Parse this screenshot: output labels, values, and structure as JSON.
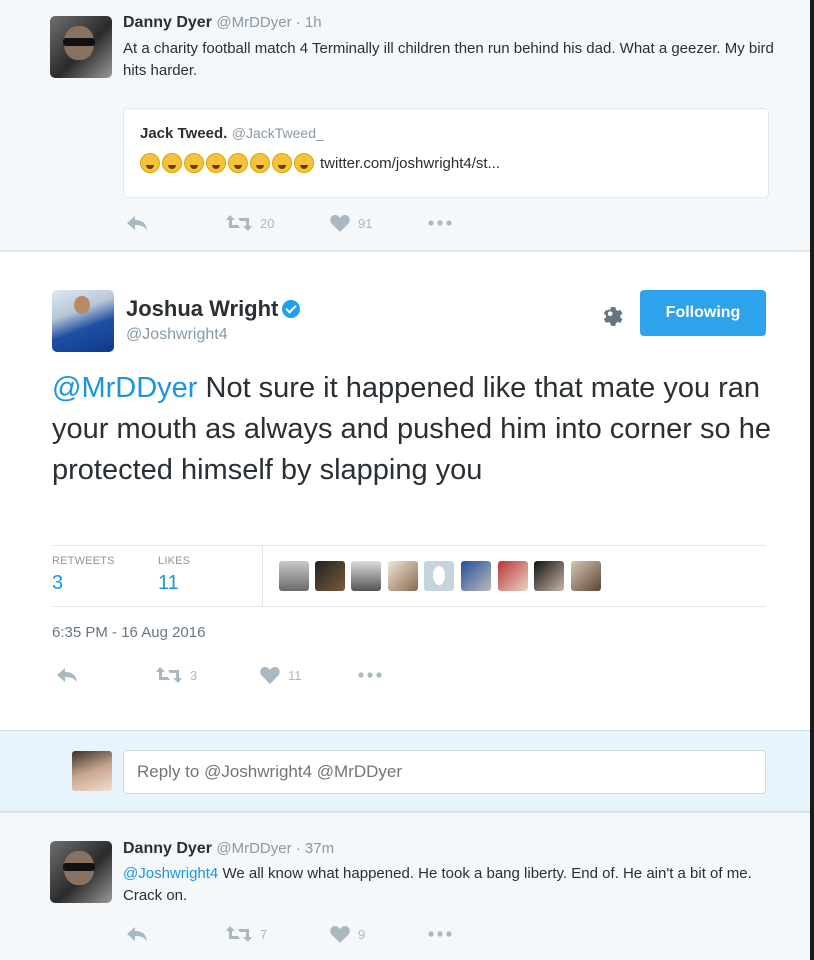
{
  "top_tweet": {
    "name": "Danny Dyer",
    "handle": "@MrDDyer · 1h",
    "text": "At a charity football match 4 Terminally ill children then run behind his dad. What a geezer. My bird hits harder.",
    "quote": {
      "name": "Jack Tweed.",
      "handle": "@JackTweed_",
      "link": "twitter.com/joshwright4/st..."
    },
    "retweets": "20",
    "likes": "91"
  },
  "main_tweet": {
    "name": "Joshua Wright",
    "handle": "@Joshwright4",
    "follow_label": "Following",
    "mention": "@MrDDyer",
    "text": " Not sure it happened like that mate you ran your mouth as always and pushed him into corner so he protected himself by slapping you",
    "retweets_label": "RETWEETS",
    "retweets_count": "3",
    "likes_label": "LIKES",
    "likes_count": "11",
    "timestamp": "6:35 PM - 16 Aug 2016",
    "action_retweets": "3",
    "action_likes": "11"
  },
  "reply_bar": {
    "placeholder": "Reply to @Joshwright4 @MrDDyer"
  },
  "bottom_tweet": {
    "name": "Danny Dyer",
    "handle": "@MrDDyer · 37m",
    "mention": "@Joshwright4",
    "text": " We all know what happened.  He took a bang liberty. End of.  He ain't a bit of me. Crack on.",
    "retweets": "7",
    "likes": "9"
  },
  "colors": {
    "accent": "#1da1f2",
    "link": "#1b95e0",
    "icon_grey": "#aab8c2"
  }
}
